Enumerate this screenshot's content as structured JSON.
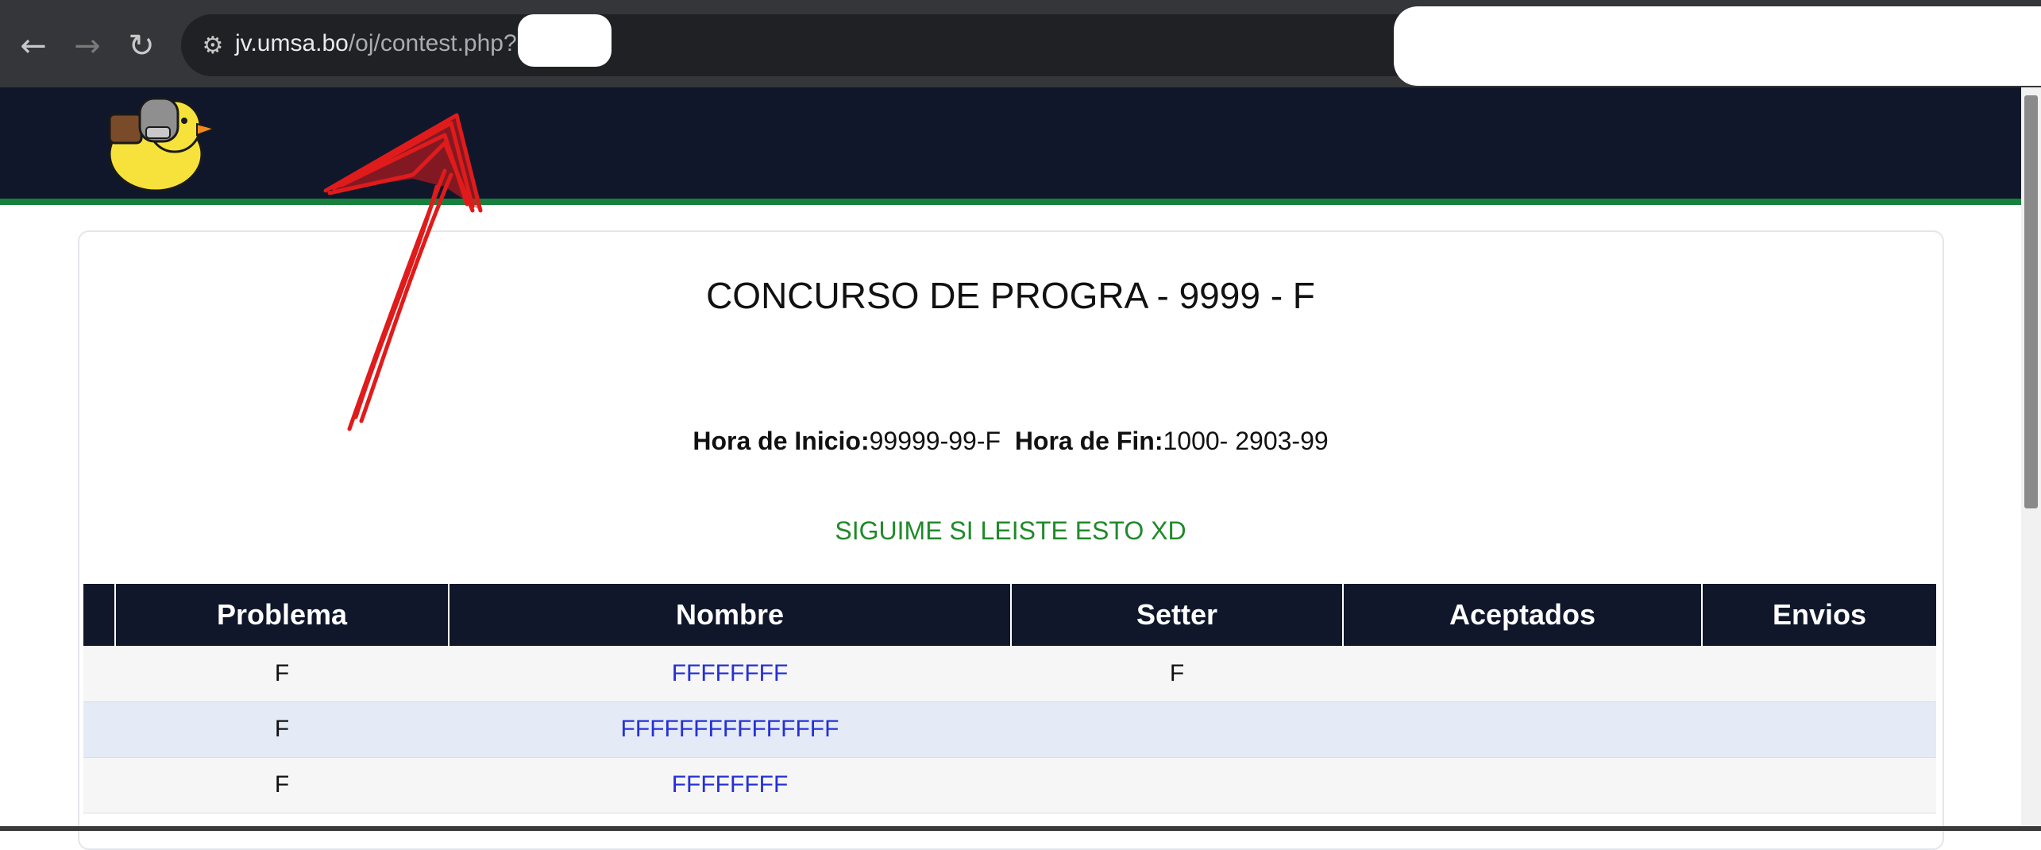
{
  "browser": {
    "back_icon": "←",
    "forward_icon": "→",
    "reload_icon": "↻",
    "site_info_icon": "⚙",
    "url_host": "jv.umsa.bo",
    "url_path": "/oj/contest.php?cid="
  },
  "contest": {
    "title": "CONCURSO DE PROGRA - 9999 - F",
    "start_label": "Hora de Inicio:",
    "start_value": "99999-99-F",
    "end_label": "Hora de Fin:",
    "end_value": "1000- 2903-99",
    "notice": "SIGUIME SI LEISTE ESTO XD"
  },
  "table": {
    "headers": [
      "",
      "Problema",
      "Nombre",
      "Setter",
      "Aceptados",
      "Envios"
    ],
    "rows": [
      {
        "problem": "F",
        "name": "FFFFFFFF",
        "setter": "F",
        "accepted": "",
        "submissions": ""
      },
      {
        "problem": "F",
        "name": "FFFFFFFFFFFFFFF",
        "setter": "",
        "accepted": "",
        "submissions": ""
      },
      {
        "problem": "F",
        "name": "FFFFFFFF",
        "setter": "",
        "accepted": "",
        "submissions": ""
      }
    ]
  },
  "colors": {
    "header_bg": "#10172a",
    "stripe": "#16803c",
    "link": "#2531d4",
    "notice": "#1f8a2a",
    "annotation": "#e01b1b"
  }
}
